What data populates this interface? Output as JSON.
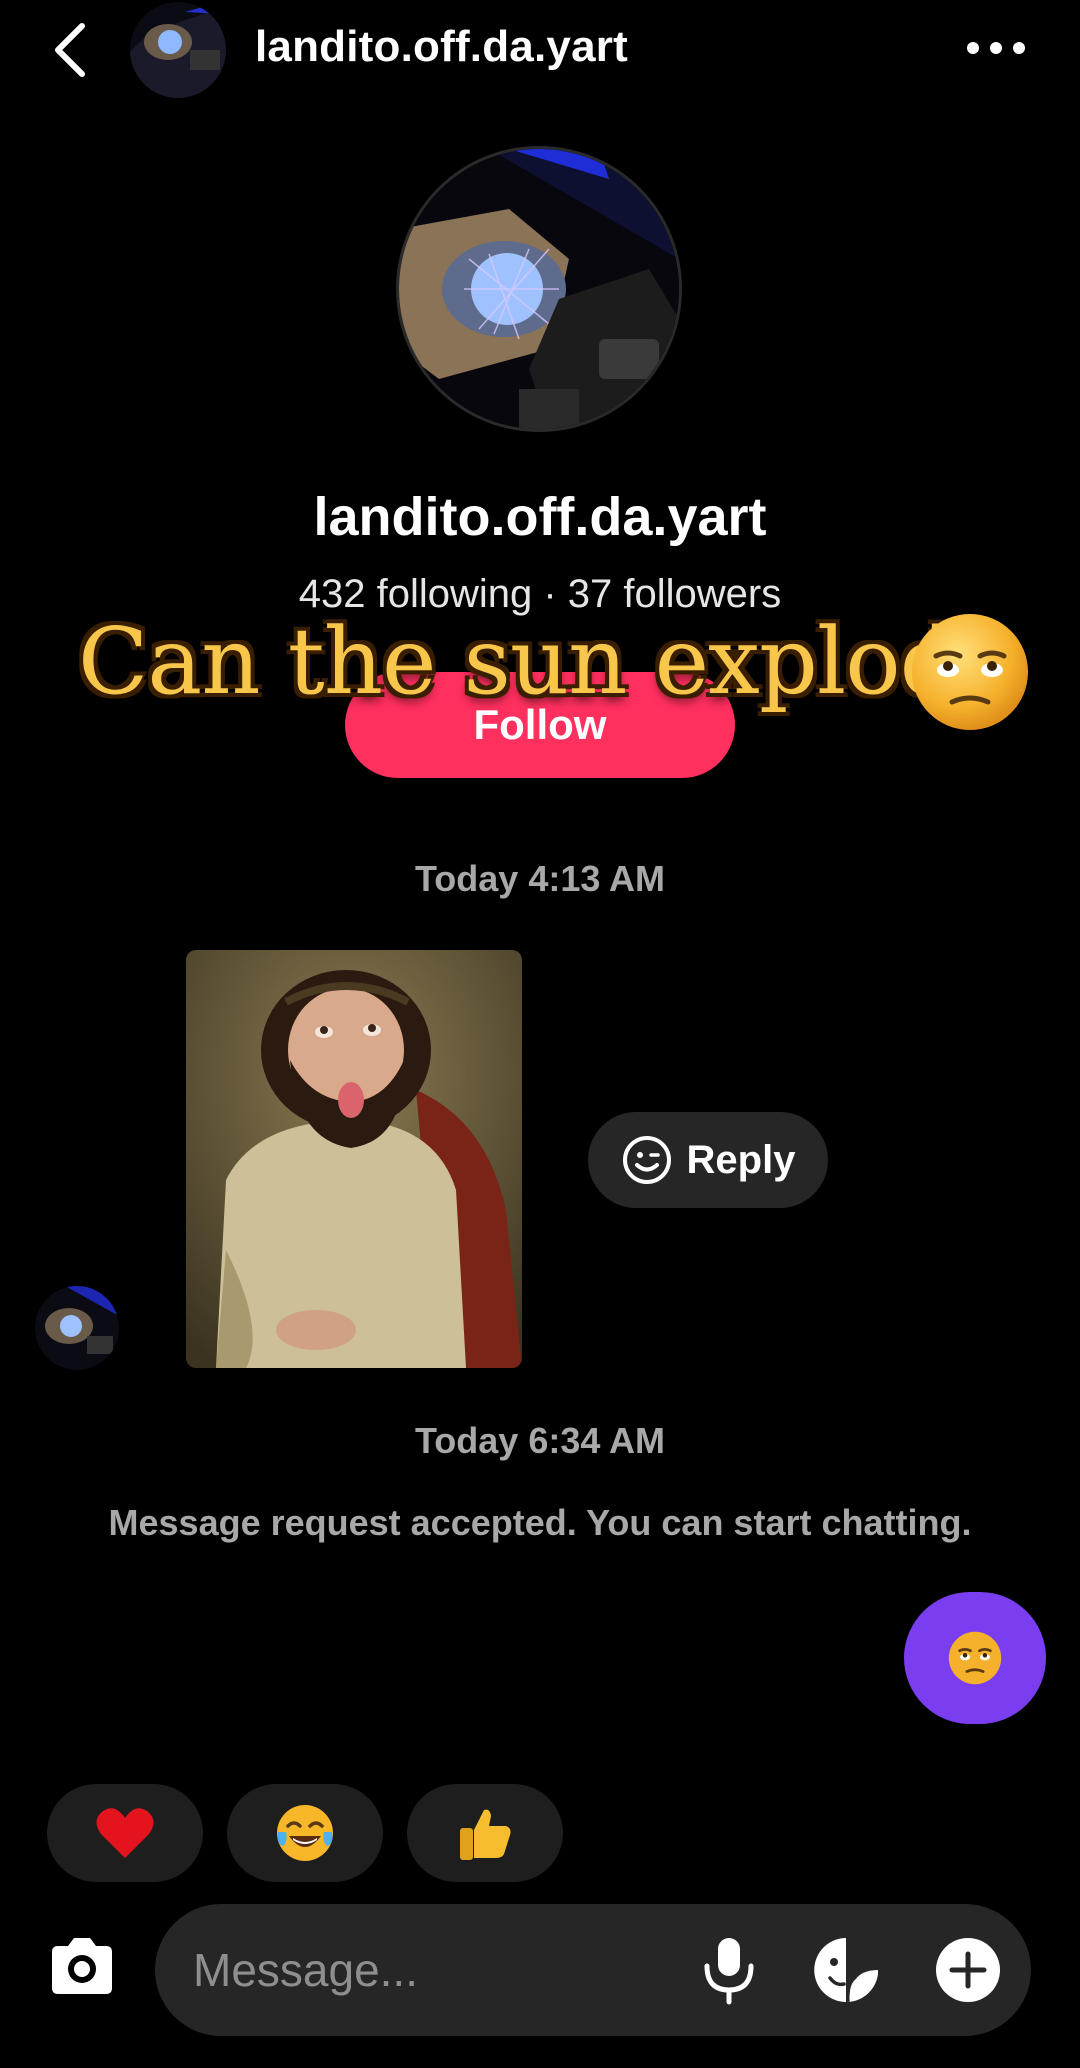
{
  "header": {
    "username": "landito.off.da.yart",
    "back_icon": "chevron-left-icon",
    "more_icon": "more-horizontal-icon"
  },
  "profile": {
    "name": "landito.off.da.yart",
    "stats": "432 following · 37 followers",
    "follow_label": "Follow",
    "follow_color": "#ff2f5e"
  },
  "overlay": {
    "caption": "Can the sun explode",
    "emoji_icon": "unamused-face-icon"
  },
  "chat": {
    "timestamp_1": "Today 4:13 AM",
    "reply_label": "Reply",
    "timestamp_2": "Today 6:34 AM",
    "system_message": "Message request accepted. You can start chatting.",
    "sent_bubble_color": "#7a3ef0"
  },
  "reactions": [
    {
      "icon": "red-heart-icon"
    },
    {
      "icon": "tears-of-joy-icon"
    },
    {
      "icon": "thumbs-up-icon"
    }
  ],
  "composer": {
    "placeholder": "Message...",
    "value": ""
  }
}
